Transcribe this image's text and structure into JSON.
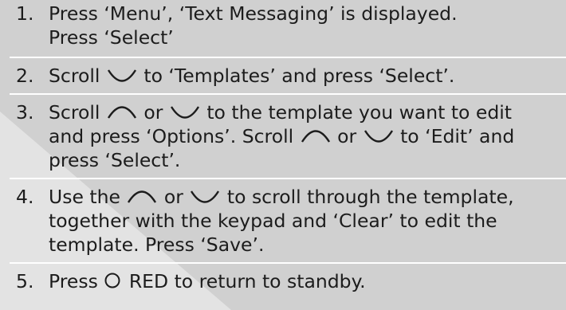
{
  "colors": {
    "background": "#d0d0d0",
    "light_region": "#e3e3e3",
    "divider": "#ffffff",
    "text": "#1c1c1c"
  },
  "icons": {
    "up_scroll": "arc-up-icon",
    "down_scroll": "arc-down-icon",
    "red_button": "circle-red-button-icon"
  },
  "steps": [
    {
      "number": "1.",
      "line1": "Press ‘Menu’, ‘Text Messaging’ is displayed.",
      "line2": "Press ‘Select’"
    },
    {
      "number": "2.",
      "t1": "Scroll ",
      "t2": " to ‘Templates’ and press ‘Select’."
    },
    {
      "number": "3.",
      "t1": "Scroll ",
      "t2": " or ",
      "t3": " to the template you want to edit",
      "t4": "and press ‘Options’.  Scroll ",
      "t5": " or ",
      "t6": " to ‘Edit’ and",
      "t7": "press ‘Select’."
    },
    {
      "number": "4.",
      "t1": "Use the ",
      "t2": " or ",
      "t3": " to scroll through the template,",
      "t4": "together with the keypad and ‘Clear’ to edit the",
      "t5": "template.  Press ‘Save’."
    },
    {
      "number": "5.",
      "t1": "Press ",
      "t2": "RED",
      "t3": " to return to standby."
    }
  ]
}
